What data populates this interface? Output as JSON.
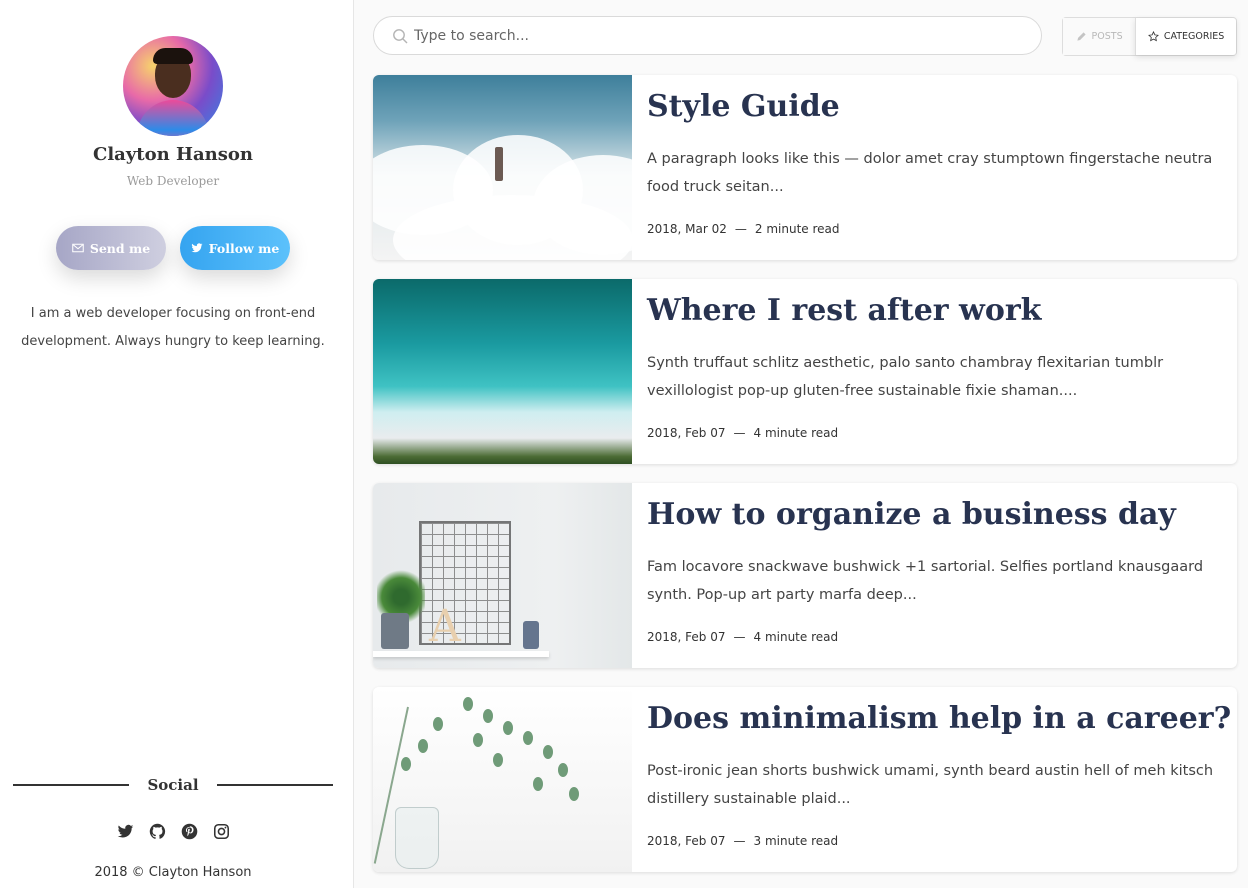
{
  "profile": {
    "name": "Clayton Hanson",
    "role": "Web Developer",
    "send_label": "Send me",
    "follow_label": "Follow me",
    "bio": "I am a web developer focusing on front-end development. Always hungry to keep learning."
  },
  "social": {
    "heading": "Social",
    "icons": [
      "twitter-icon",
      "github-icon",
      "pinterest-icon",
      "instagram-icon"
    ]
  },
  "footer": {
    "copyright": "2018 © Clayton Hanson"
  },
  "search": {
    "placeholder": "Type to search..."
  },
  "tabs": {
    "posts": "POSTS",
    "categories": "CATEGORIES"
  },
  "colors": {
    "title": "#283350",
    "follow": "#35a4f0",
    "send": "#a6a6c6"
  },
  "posts": [
    {
      "title": "Style Guide",
      "excerpt": "A paragraph looks like this — dolor amet cray stumptown fingerstache neutra food truck seitan...",
      "date": "2018, Mar 02",
      "read": "2 minute read"
    },
    {
      "title": "Where I rest after work",
      "excerpt": "Synth truffaut schlitz aesthetic, palo santo chambray flexitarian tumblr vexillologist pop-up gluten-free sustainable fixie shaman....",
      "date": "2018, Feb 07",
      "read": "4 minute read"
    },
    {
      "title": "How to organize a business day",
      "excerpt": "Fam locavore snackwave bushwick +1 sartorial. Selfies portland knausgaard synth. Pop-up art party marfa deep...",
      "date": "2018, Feb 07",
      "read": "4 minute read"
    },
    {
      "title": "Does minimalism help in a career?",
      "excerpt": "Post-ironic jean shorts bushwick umami, synth beard austin hell of meh kitsch distillery sustainable plaid...",
      "date": "2018, Feb 07",
      "read": "3 minute read"
    }
  ]
}
